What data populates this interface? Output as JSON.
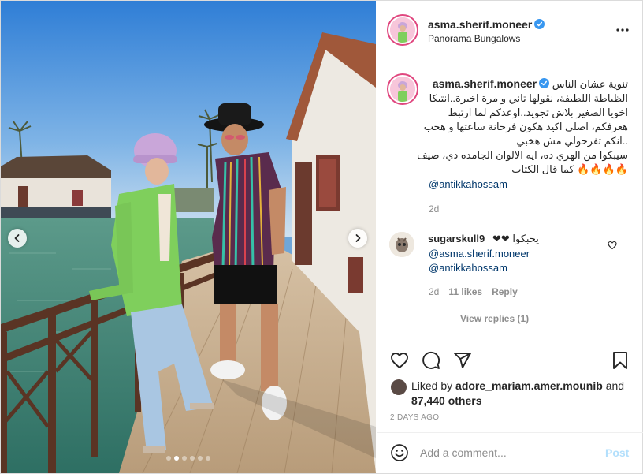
{
  "post": {
    "username": "asma.sherif.moneer",
    "location": "Panorama Bungalows",
    "verified": true,
    "caption_lines": [
      "تنوية عشان الناس",
      "الظياطة اللطيفة، نقولها تاني و مرة اخيرة..انتيكا",
      "اخويا الصغير بلاش تجويد..اوعدكم لما ارتبط",
      "هعرفكم، اصلي اكيد هكون فرحانة ساعتها و هحب",
      "..انكم تفرحولي مش هخبي",
      "سيبكوا من الهري ده، ايه الالوان الجامده دي، صيف",
      "🔥🔥🔥🔥 كما قال الكتاب"
    ],
    "caption_mention": "@antikkahossam",
    "caption_time": "2d"
  },
  "comment": {
    "username": "sugarskull9",
    "text": "يحبكوا ❤❤",
    "mentions": [
      "@asma.sherif.moneer",
      "@antikkahossam"
    ],
    "time": "2d",
    "likes": "11 likes",
    "reply_label": "Reply",
    "view_replies": "View replies (1)"
  },
  "likes": {
    "prefix": "Liked by",
    "user": "adore_mariam.amer.mounib",
    "joiner": "and",
    "others": "87,440 others"
  },
  "post_age": "2 DAYS AGO",
  "add_comment": {
    "placeholder": "Add a comment...",
    "post_label": "Post"
  },
  "carousel": {
    "slide_count": 6,
    "active_index": 1
  },
  "colors": {
    "verified": "#3897f0",
    "link": "#00376b",
    "post_disabled": "#b2dffc",
    "story_ring": "#e0477f"
  },
  "icons": [
    "more-options-icon",
    "heart-icon",
    "comment-icon",
    "share-icon",
    "bookmark-icon",
    "emoji-icon",
    "chevron-left-icon",
    "chevron-right-icon",
    "verified-badge-icon"
  ]
}
